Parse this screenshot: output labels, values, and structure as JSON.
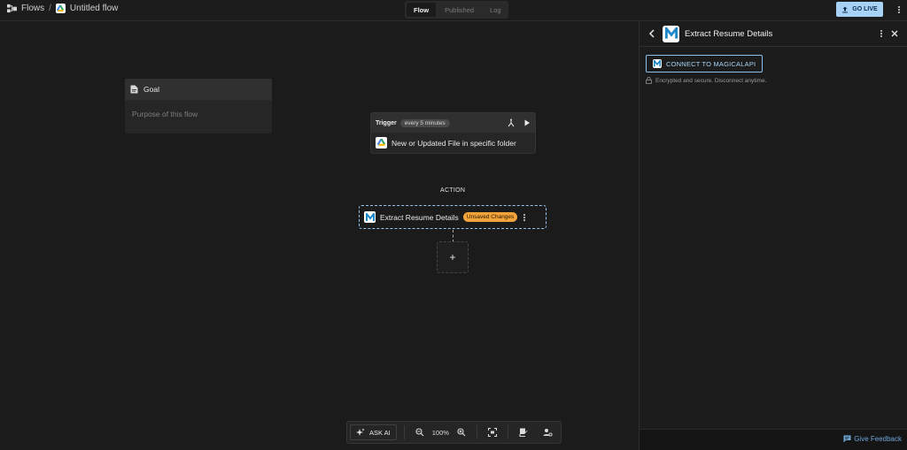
{
  "header": {
    "breadcrumb_root": "Flows",
    "breadcrumb_sep": "/",
    "flow_name": "Untitled flow",
    "tabs": [
      {
        "label": "Flow",
        "active": true
      },
      {
        "label": "Published",
        "active": false
      },
      {
        "label": "Log",
        "active": false
      }
    ],
    "go_live_label": "GO LIVE",
    "go_live_color": "#a7d1f5"
  },
  "goal": {
    "title": "Goal",
    "placeholder": "Purpose of this flow"
  },
  "trigger": {
    "label": "Trigger",
    "schedule_badge": "every 5 minutes",
    "event": "New or Updated File in specific folder"
  },
  "action": {
    "section_label": "ACTION",
    "name": "Extract Resume Details",
    "status_badge": "Unsaved Changes",
    "status_color": "#f2a43a"
  },
  "toolbar": {
    "ask_ai_label": "ASK AI",
    "zoom": "100%"
  },
  "panel": {
    "title": "Extract Resume Details",
    "connect_label": "CONNECT TO MAGICALAPI",
    "secure_note": "Encrypted and secure. Disconnect anytime.",
    "feedback_label": "Give Feedback"
  },
  "icons": {
    "flows": "flows-icon",
    "drive": "google-drive-icon",
    "upload": "upload-icon",
    "more": "more-vertical-icon",
    "document": "document-icon",
    "branch": "branch-icon",
    "play": "play-icon",
    "plus": "plus-icon",
    "sparkle": "sparkle-icon",
    "zoom_out": "zoom-out-icon",
    "zoom_in": "zoom-in-icon",
    "fit": "fit-view-icon",
    "notes": "notes-icon",
    "user_settings": "user-settings-icon",
    "back": "back-icon",
    "close": "close-icon",
    "lock": "lock-icon",
    "feedback": "feedback-icon"
  }
}
